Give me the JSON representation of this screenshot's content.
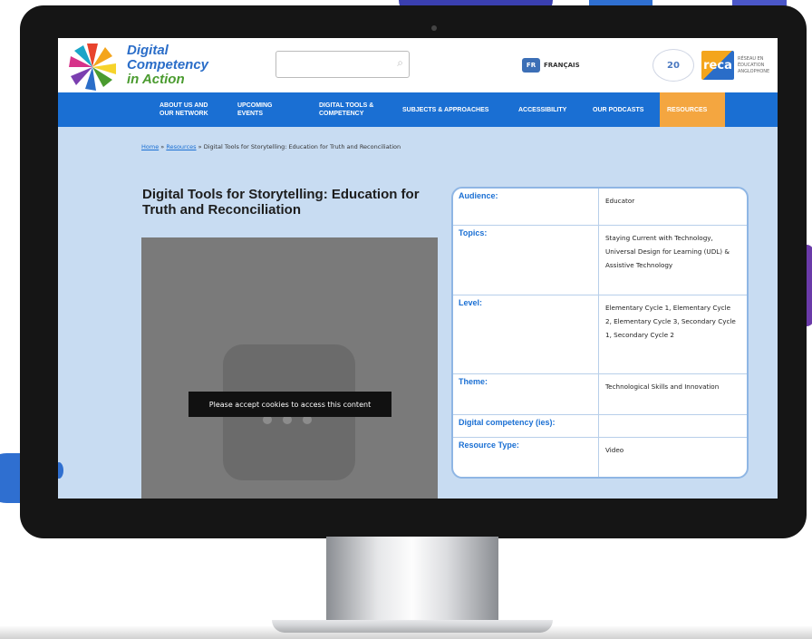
{
  "site": {
    "logo": {
      "line1": "Digital",
      "line2": "Competency",
      "line3": "in Action"
    },
    "search": {
      "placeholder": ""
    },
    "language_label": "FRANÇAIS",
    "language_icon_text": "FR",
    "anniversary_text": "20",
    "partner_logo_text": "reca",
    "partner_sub": "RÉSEAU EN ÉDUCATION ANGLOPHONE"
  },
  "nav": {
    "items": [
      {
        "label": "ABOUT US AND OUR NETWORK"
      },
      {
        "label": "UPCOMING EVENTS"
      },
      {
        "label": "DIGITAL TOOLS & COMPETENCY"
      },
      {
        "label": "SUBJECTS & APPROACHES"
      },
      {
        "label": "ACCESSIBILITY"
      },
      {
        "label": "OUR PODCASTS"
      },
      {
        "label": "RESOURCES"
      }
    ]
  },
  "breadcrumb": {
    "home": "Home",
    "resources": "Resources",
    "current": "Digital Tools for Storytelling: Education for Truth and Reconciliation",
    "sep": "»"
  },
  "page": {
    "title": "Digital Tools for Storytelling: Education for Truth and Reconciliation",
    "video_notice": "Please accept cookies to access this content"
  },
  "details": [
    {
      "key": "Audience:",
      "value": "Educator"
    },
    {
      "key": "Topics:",
      "value": "Staying Current with Technology, Universal Design for Learning (UDL) & Assistive Technology"
    },
    {
      "key": "Level:",
      "value": "Elementary Cycle 1, Elementary Cycle 2, Elementary Cycle 3, Secondary Cycle 1, Secondary Cycle 2"
    },
    {
      "key": "Theme:",
      "value": "Technological Skills and Innovation"
    },
    {
      "key": "Digital competency (ies):",
      "value": ""
    },
    {
      "key": "Resource Type:",
      "value": "Video"
    }
  ],
  "colors": {
    "nav_blue": "#1a6fd3",
    "accent_orange": "#f4a640",
    "page_bg": "#c8dcf2"
  }
}
